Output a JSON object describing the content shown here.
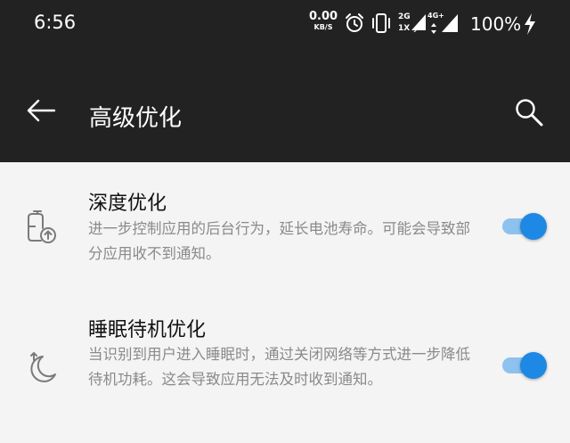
{
  "status_bar": {
    "time": "6:56",
    "net_speed_value": "0.00",
    "net_speed_unit": "KB/S",
    "sim1_label_top": "2G",
    "sim1_label_bottom": "1X",
    "sim2_label": "4G+",
    "battery": "100%"
  },
  "header": {
    "title": "高级优化"
  },
  "settings": [
    {
      "title": "深度优化",
      "description": "进一步控制应用的后台行为，延长电池寿命。可能会导致部分应用收不到通知。",
      "enabled": true,
      "icon": "battery-up-icon"
    },
    {
      "title": "睡眠待机优化",
      "description": "当识别到用户进入睡眠时，通过关闭网络等方式进一步降低待机功耗。这会导致应用无法及时收到通知。",
      "enabled": true,
      "icon": "moon-sleep-icon"
    }
  ],
  "colors": {
    "bar_background": "#222222",
    "page_background": "#f4f4f4",
    "toggle_thumb": "#1e88e5",
    "toggle_track": "#8ec2ee"
  }
}
